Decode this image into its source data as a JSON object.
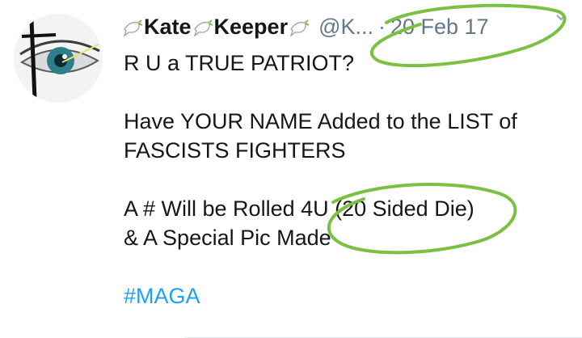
{
  "tweet": {
    "author_name_prefix_icon": "dove-icon",
    "author_name_parts": [
      "Kate",
      "Keeper"
    ],
    "handle": "@K...",
    "separator": "·",
    "date": "20 Feb 17",
    "menu_icon": "chevron-down-icon",
    "lines": [
      "R U a TRUE PATRIOT?",
      "",
      "Have YOUR NAME Added to the LIST of",
      "FASCISTS FIGHTERS",
      "",
      "A # Will be Rolled 4U (20 Sided Die)",
      "& A Special Pic Made",
      ""
    ],
    "hashtag": "#MAGA"
  },
  "annotation": {
    "circle_color": "#7ac142"
  }
}
